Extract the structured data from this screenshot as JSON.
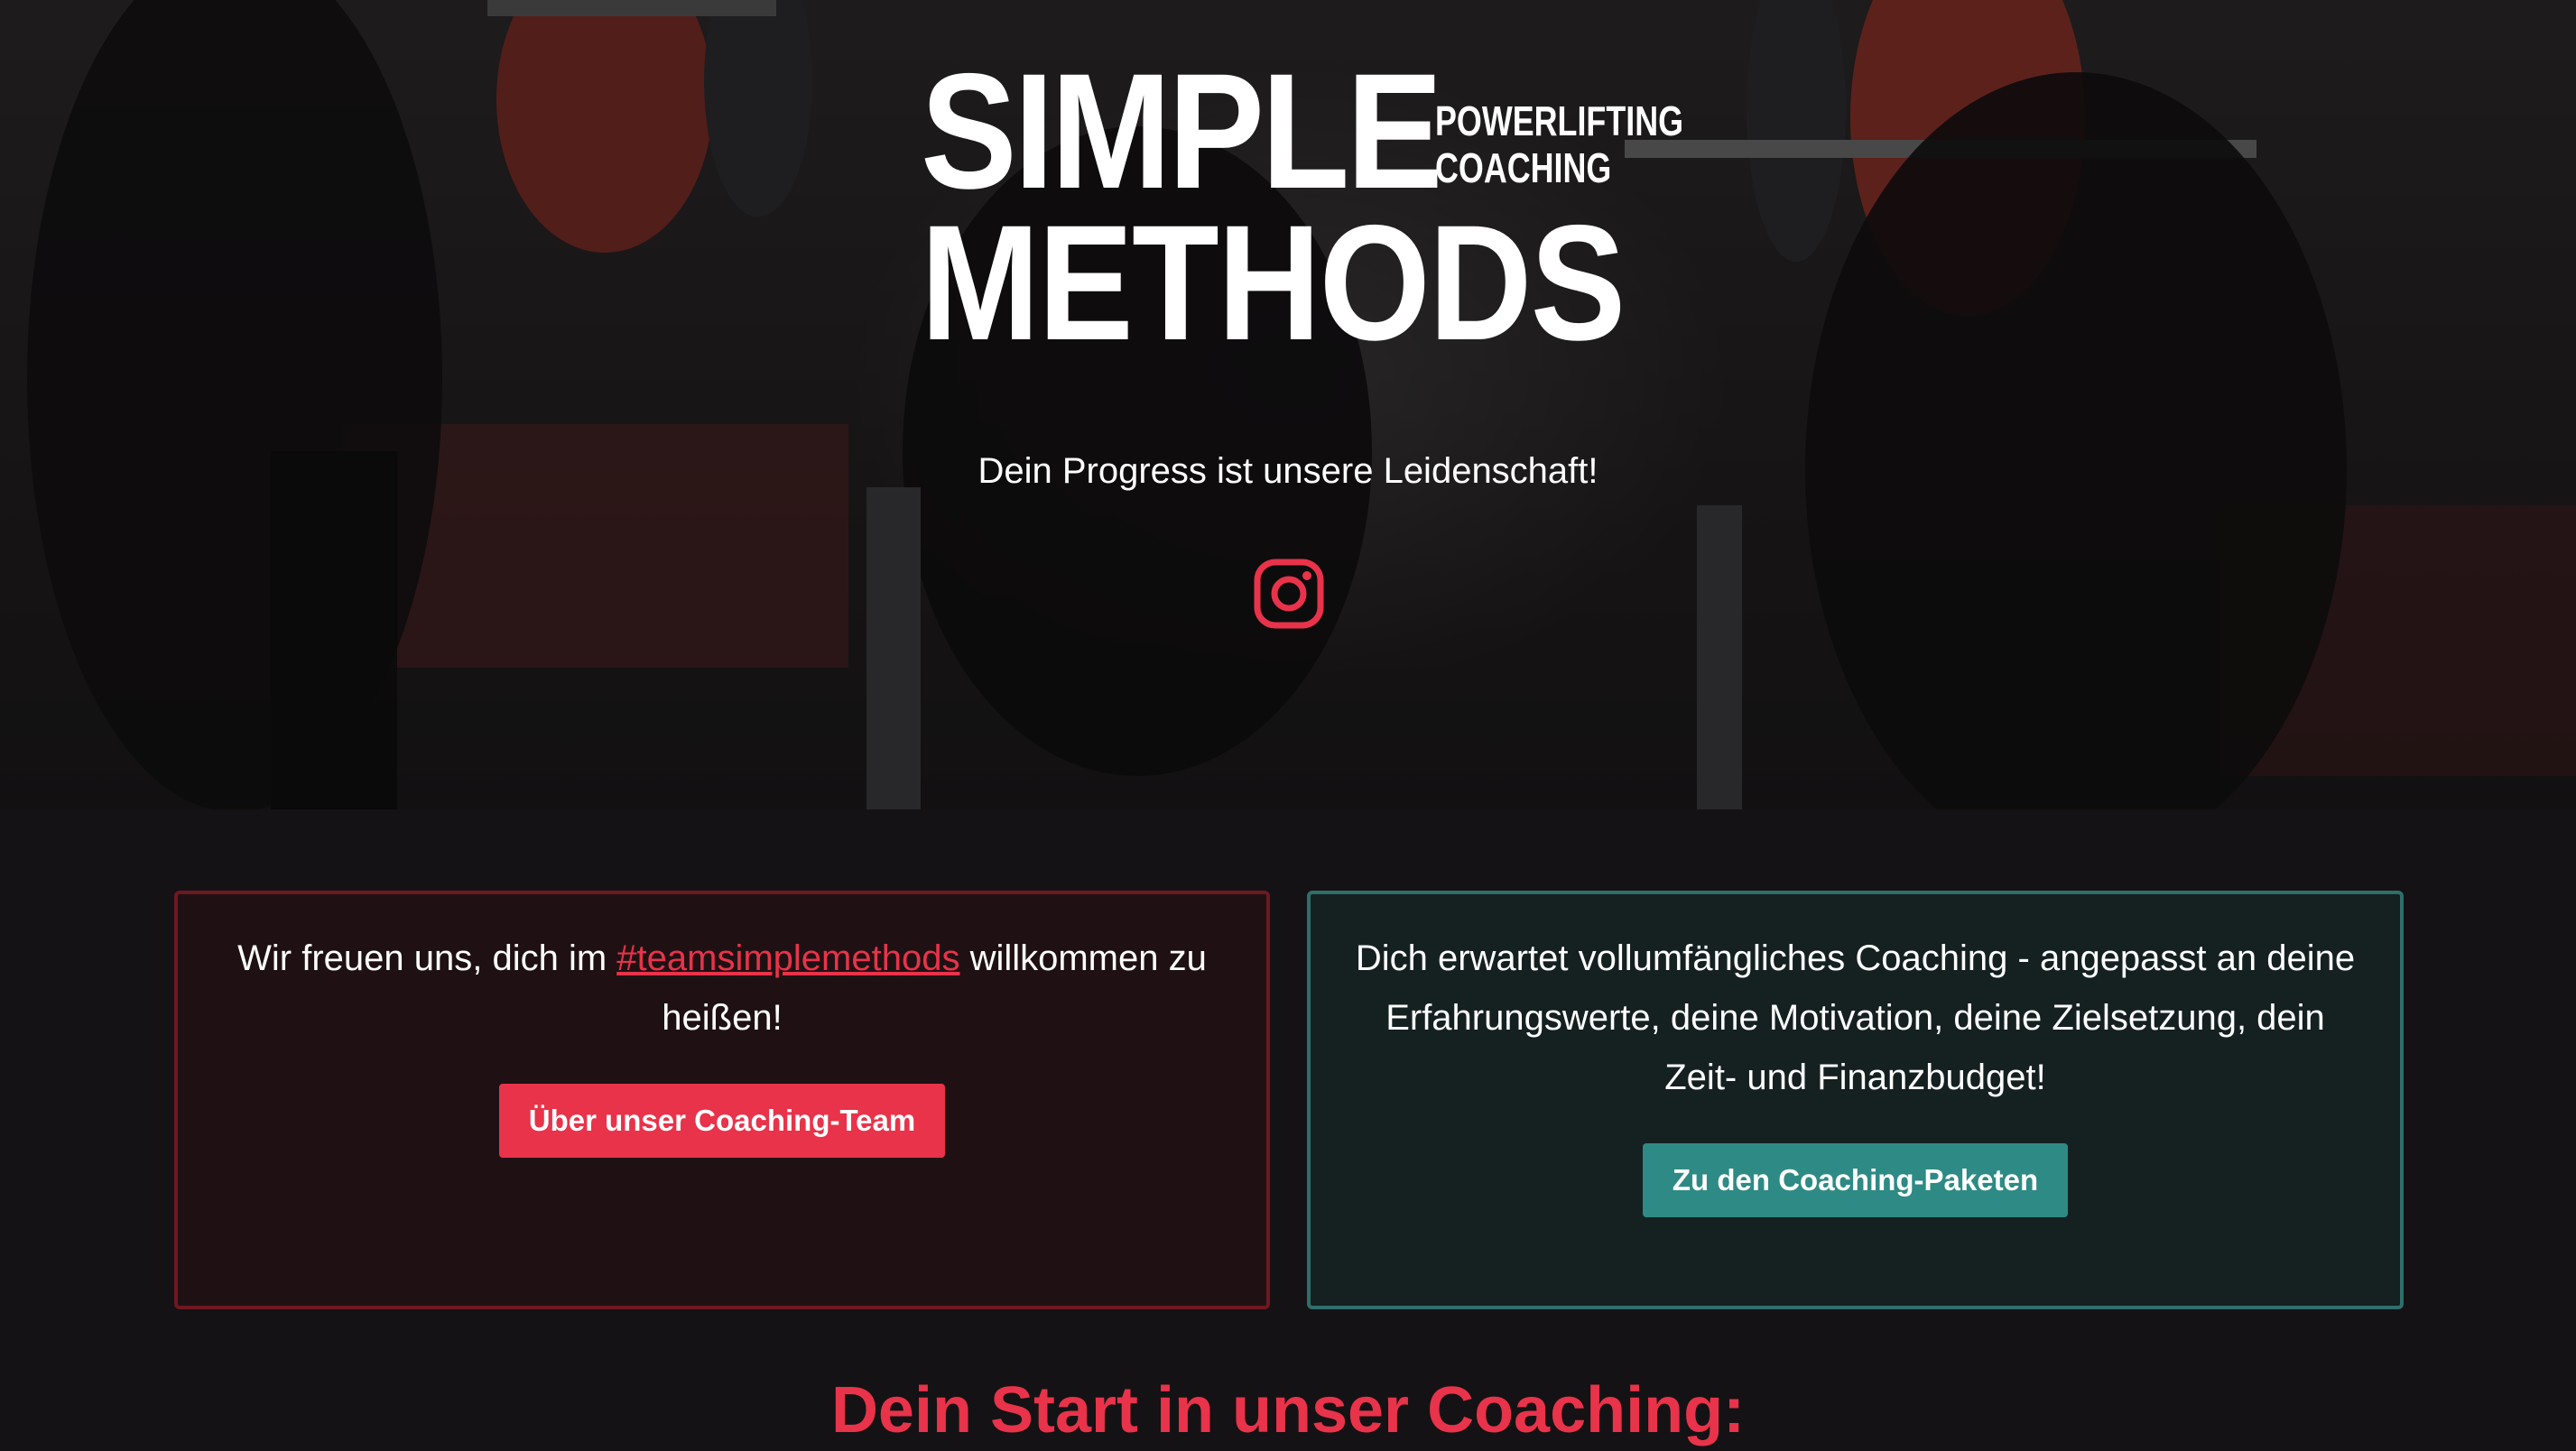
{
  "hero": {
    "logo": {
      "line1": "SIMPLE",
      "line2": "METHODS",
      "sub1": "POWERLIFTING",
      "sub2": "COACHING"
    },
    "tagline": "Dein Progress ist unsere Leidenschaft!",
    "social_icon": "instagram-icon"
  },
  "cards": {
    "team": {
      "text_before": "Wir freuen uns, dich im ",
      "hashtag": "#teamsimplemethods",
      "text_after": " willkommen zu heißen!",
      "button": "Über unser Coaching-Team"
    },
    "packages": {
      "text": "Dich erwartet vollumfängliches Coaching - angepasst an deine Erfahrungswerte, deine Motivation, deine Zielsetzung, dein Zeit- und Finanzbudget!",
      "button": "Zu den Coaching-Paketen"
    }
  },
  "section": {
    "title": "Dein Start in unser Coaching:"
  },
  "colors": {
    "accent_red": "#e8334a",
    "accent_teal": "#2e8a84",
    "background": "#141214"
  }
}
